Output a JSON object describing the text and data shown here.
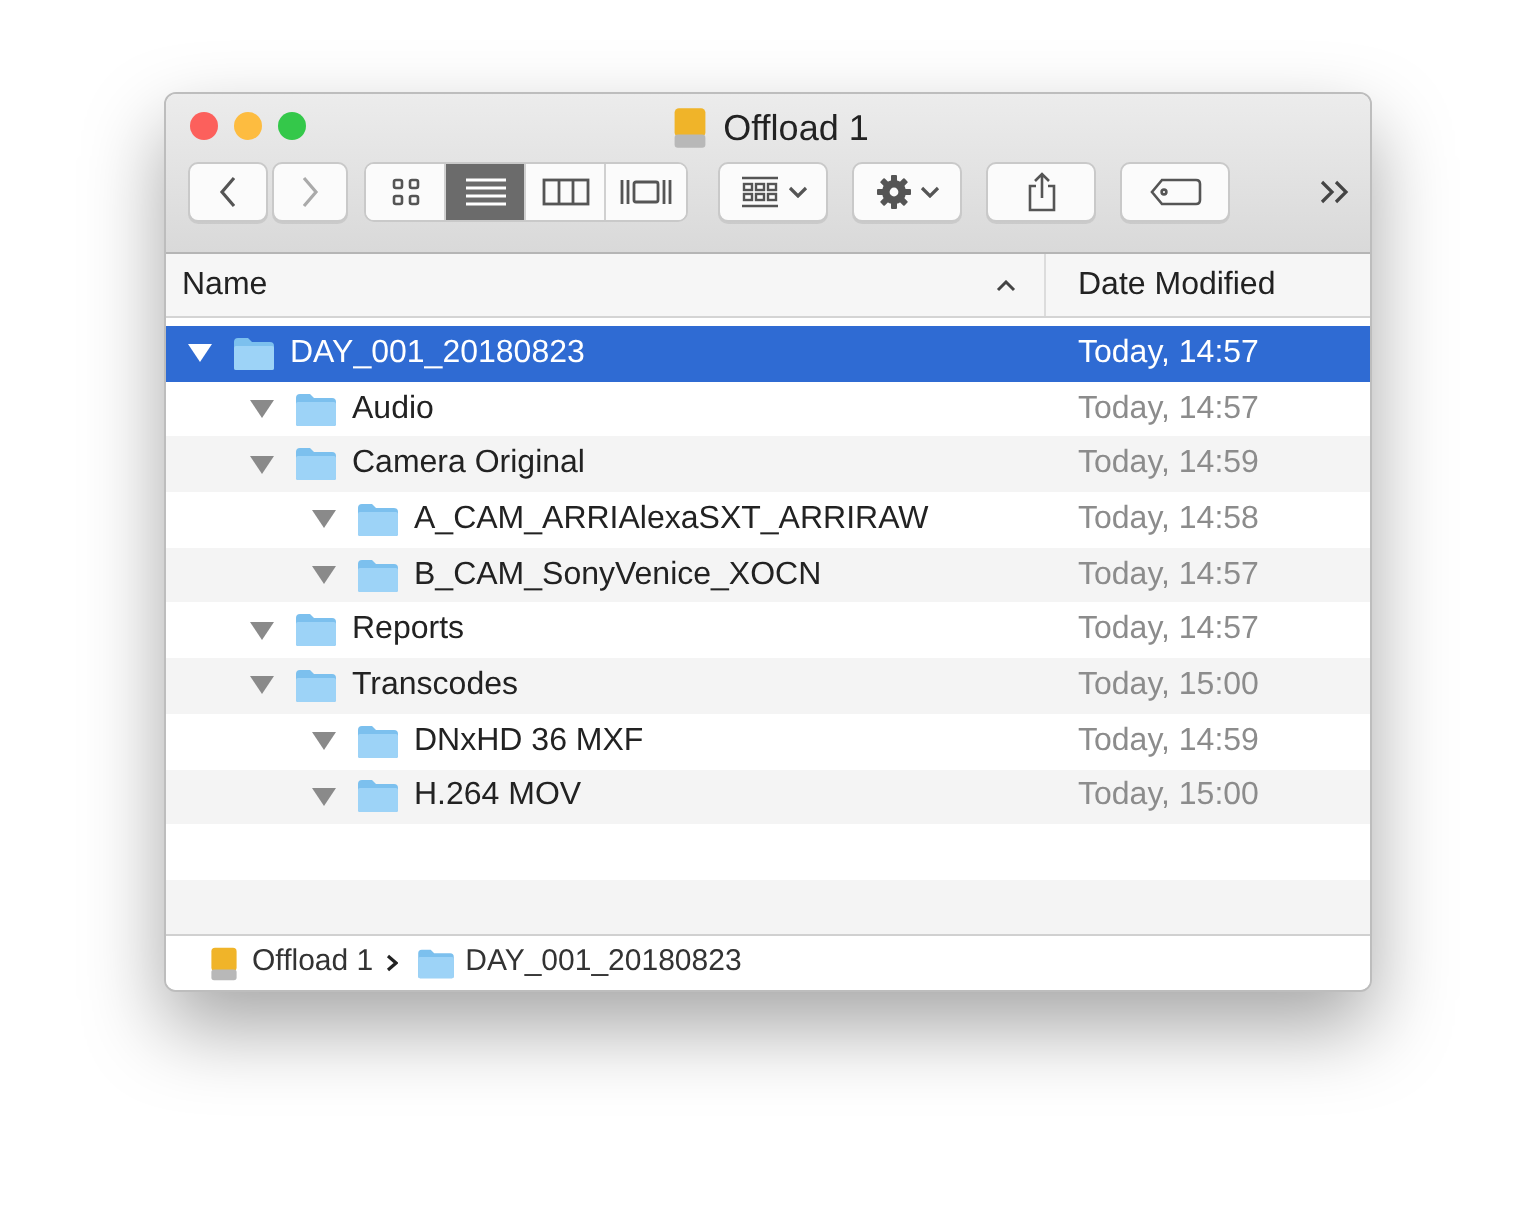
{
  "window": {
    "title": "Offload 1"
  },
  "toolbar": {
    "views": [
      {
        "kind": "icons",
        "selected": false
      },
      {
        "kind": "list",
        "selected": true
      },
      {
        "kind": "columns",
        "selected": false
      },
      {
        "kind": "gallery",
        "selected": false
      }
    ]
  },
  "table": {
    "columns": [
      {
        "label": "Name",
        "sorted": true
      },
      {
        "label": "Date Modified",
        "sorted": false
      }
    ],
    "rows": [
      {
        "name": "DAY_001_20180823",
        "date": "Today, 14:57",
        "selected": true,
        "expanded": true,
        "children": [
          {
            "name": "Audio",
            "date": "Today, 14:57",
            "selected": false,
            "expanded": true
          },
          {
            "name": "Camera Original",
            "date": "Today, 14:59",
            "selected": false,
            "expanded": true,
            "children": [
              {
                "name": "A_CAM_ARRIAlexaSXT_ARRIRAW",
                "date": "Today, 14:58",
                "selected": false,
                "expanded": true
              },
              {
                "name": "B_CAM_SonyVenice_XOCN",
                "date": "Today, 14:57",
                "selected": false,
                "expanded": true
              }
            ]
          },
          {
            "name": "Reports",
            "date": "Today, 14:57",
            "selected": false,
            "expanded": true
          },
          {
            "name": "Transcodes",
            "date": "Today, 15:00",
            "selected": false,
            "expanded": true,
            "children": [
              {
                "name": "DNxHD 36 MXF",
                "date": "Today, 14:59",
                "selected": false,
                "expanded": true
              },
              {
                "name": "H.264 MOV",
                "date": "Today, 15:00",
                "selected": false,
                "expanded": true
              }
            ]
          }
        ]
      }
    ]
  },
  "path_bar": [
    {
      "kind": "drive",
      "label": "Offload 1"
    },
    {
      "kind": "folder",
      "label": "DAY_001_20180823"
    }
  ]
}
